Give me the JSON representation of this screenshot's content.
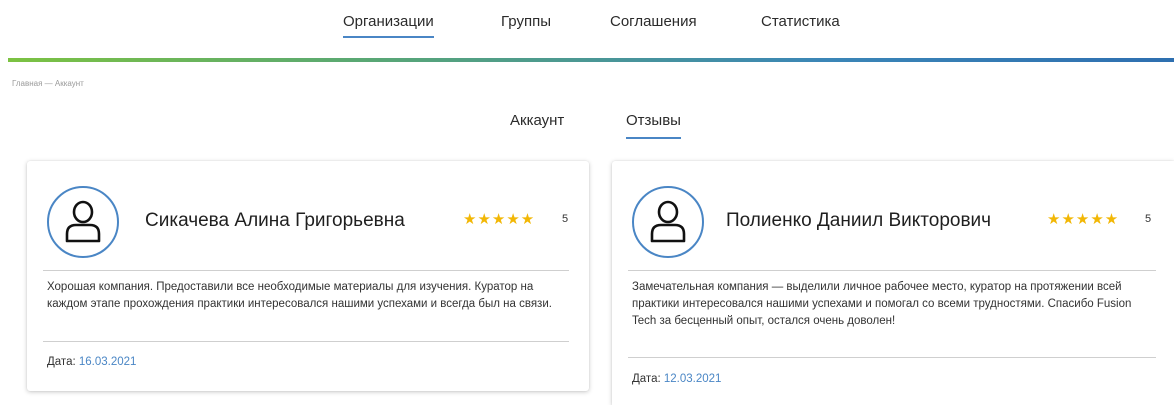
{
  "nav": {
    "items": [
      {
        "label": "Организации",
        "active": true
      },
      {
        "label": "Группы",
        "active": false
      },
      {
        "label": "Соглашения",
        "active": false
      },
      {
        "label": "Статистика",
        "active": false
      }
    ]
  },
  "breadcrumb": "Главная — Аккаунт",
  "tabs": [
    {
      "label": "Аккаунт",
      "active": false
    },
    {
      "label": "Отзывы",
      "active": true
    }
  ],
  "reviews": [
    {
      "name": "Сикачева Алина Григорьевна",
      "stars": "★★★★★",
      "rating": "5",
      "text": "Хорошая компания. Предоставили все необходимые материалы для изучения. Куратор на каждом этапе прохождения практики интересовался нашими успехами и всегда был на связи.",
      "date_label": "Дата: ",
      "date": "16.03.2021"
    },
    {
      "name": "Полиенко Даниил Викторович",
      "stars": "★★★★★",
      "rating": "5",
      "text": "Замечательная компания — выделили личное рабочее место, куратор на протяжении всей практики интересовался нашими успехами и помогал со всеми трудностями. Спасибо Fusion Tech за бесценный опыт, остался очень доволен!",
      "date_label": "Дата: ",
      "date": "12.03.2021"
    }
  ],
  "colors": {
    "accent": "#4a86c5",
    "star": "#f2b705",
    "bar_start": "#7cc242",
    "bar_end": "#2e6fb0"
  },
  "icons": {
    "avatar": "user-icon",
    "rating": "star-icon"
  }
}
